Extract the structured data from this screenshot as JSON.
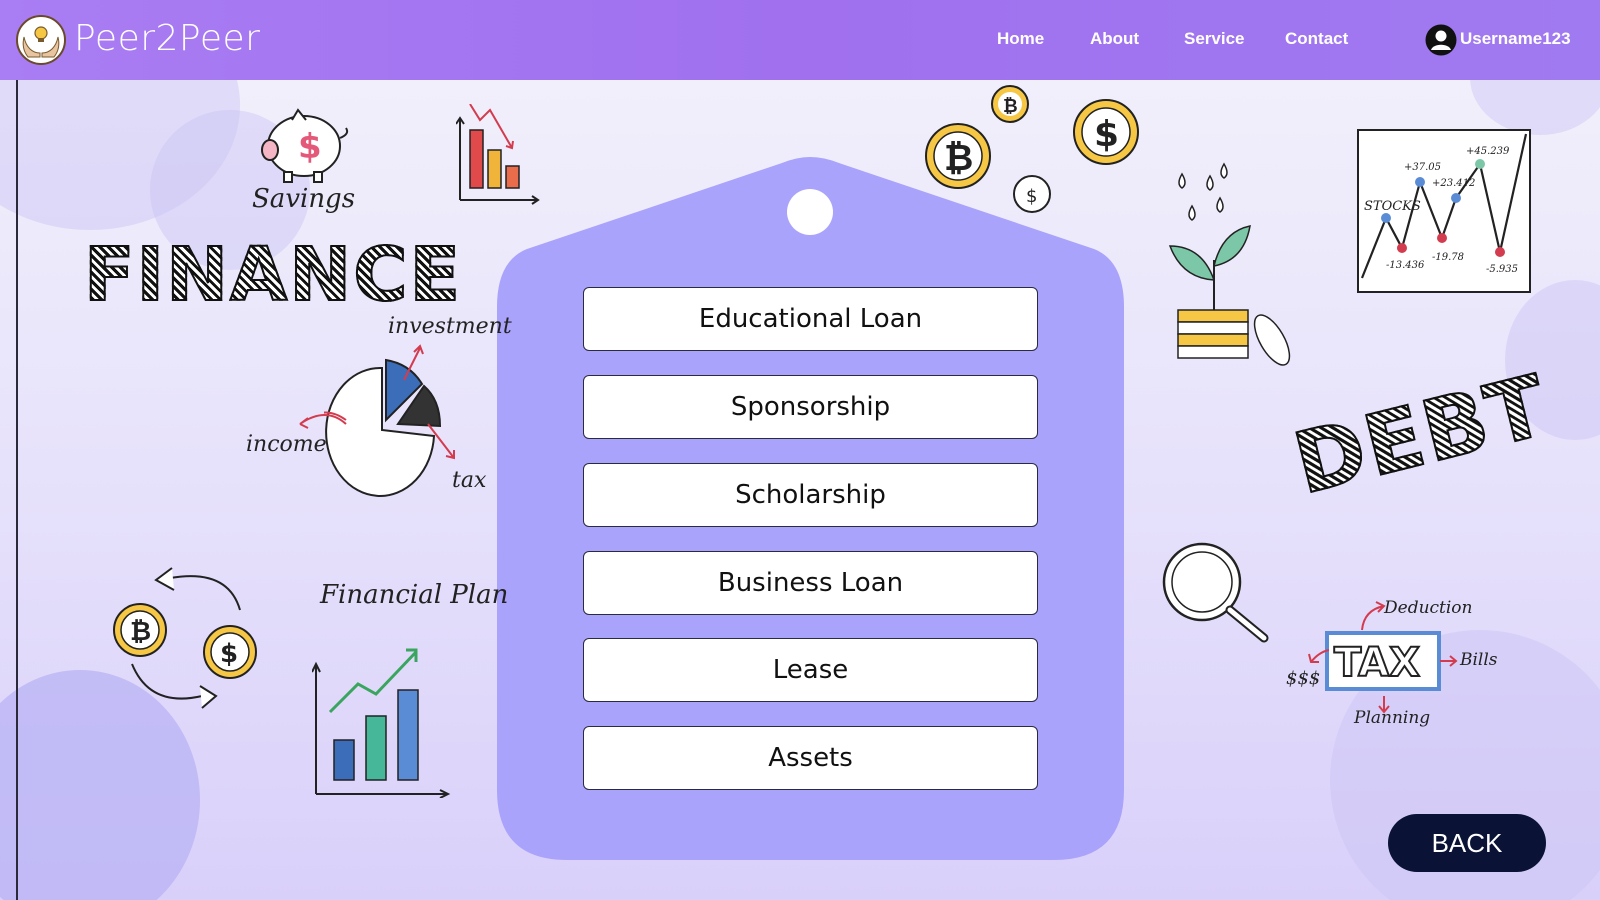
{
  "brand": {
    "name": "Peer2Peer"
  },
  "nav": {
    "links": [
      {
        "label": "Home"
      },
      {
        "label": "About"
      },
      {
        "label": "Service"
      },
      {
        "label": "Contact"
      }
    ],
    "username": "Username123"
  },
  "options": [
    {
      "label": "Educational Loan"
    },
    {
      "label": "Sponsorship"
    },
    {
      "label": "Scholarship"
    },
    {
      "label": "Business Loan"
    },
    {
      "label": "Lease"
    },
    {
      "label": "Assets"
    }
  ],
  "doodles": {
    "finance": "FINANCE",
    "debt": "DEBT",
    "savings": "Savings",
    "investment": "investment",
    "income": "income",
    "tax_small": "tax",
    "financial_plan": "Financial Plan",
    "stocks": "STOCKS",
    "stock_labels": [
      "+37.05",
      "+23.412",
      "+45.239",
      "-13.436",
      "-19.78",
      "-5.935"
    ],
    "tax_big": "TAX",
    "deduction": "Deduction",
    "bills": "Bills",
    "money": "$$$",
    "planning": "Planning"
  },
  "back_button": {
    "label": "BACK"
  },
  "colors": {
    "navbar": "#a578f2",
    "tag": "#a9a3fb",
    "back_button": "#0a1336",
    "accent_red": "#d33c4f",
    "accent_gold": "#f1c232"
  }
}
